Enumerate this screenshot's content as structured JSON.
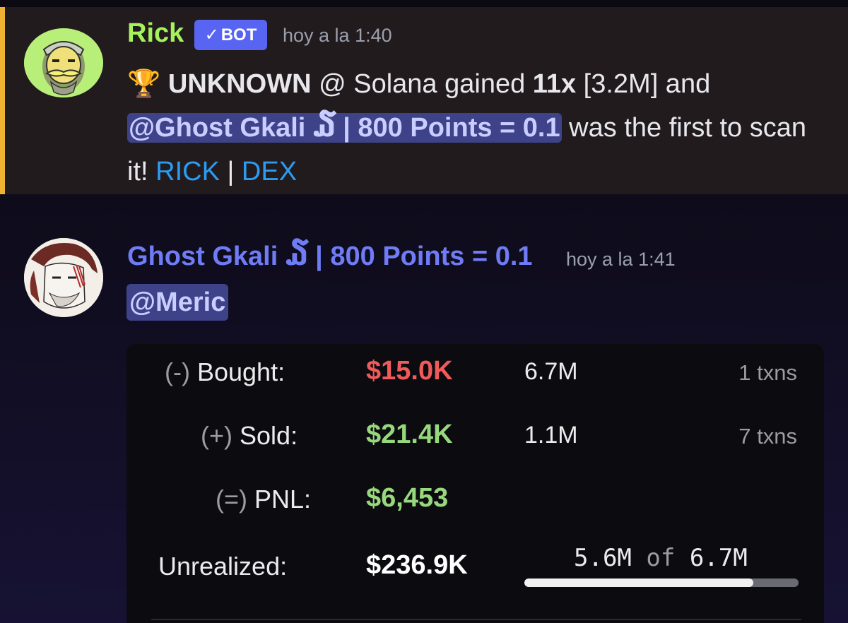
{
  "bot_message": {
    "username": "Rick",
    "badge": "BOT",
    "badge_check": "✓",
    "timestamp": "hoy a la 1:40",
    "trophy": "🏆",
    "token": "UNKNOWN",
    "text_at_chain": " @ Solana gained ",
    "gain": "11x",
    "text_mcap": " [3.2M] and ",
    "mention": "@Ghost Gkali ໓ | 800 Points = 0.1",
    "text_after_mention": " was the first to scan it! ",
    "link_rick": "RICK",
    "separator": " | ",
    "link_dex": "DEX"
  },
  "user_message": {
    "username": "Ghost Gkali ໓ | 800 Points = 0.1",
    "timestamp": "hoy a la 1:41",
    "mention": "@Meric"
  },
  "pnl_card": {
    "bought": {
      "prefix": "(-)",
      "label": "Bought:",
      "value": "$15.0K",
      "qty": "6.7M",
      "txns": "1 txns"
    },
    "sold": {
      "prefix": "(+)",
      "label": "Sold:",
      "value": "$21.4K",
      "qty": "1.1M",
      "txns": "7 txns"
    },
    "pnl": {
      "prefix": "(=)",
      "label": "PNL:",
      "value": "$6,453"
    },
    "unrealized": {
      "label": "Unrealized:",
      "value": "$236.9K",
      "held": "5.6M",
      "of_word": "of",
      "total": "6.7M",
      "held_fraction": 0.836
    }
  },
  "colors": {
    "bot_name": "#a6f25c",
    "bot_badge": "#5865f2",
    "mention_bg": "#3e4289",
    "link": "#2b9cf2",
    "user_name": "#6f7cf5",
    "negative": "#f05a5a",
    "positive": "#98d87c",
    "highlight_bar": "#f0b232"
  },
  "icons": {
    "rick_avatar": "rick-avatar",
    "ghost_avatar": "ghost-avatar",
    "trophy": "trophy-icon",
    "check": "check-icon"
  }
}
